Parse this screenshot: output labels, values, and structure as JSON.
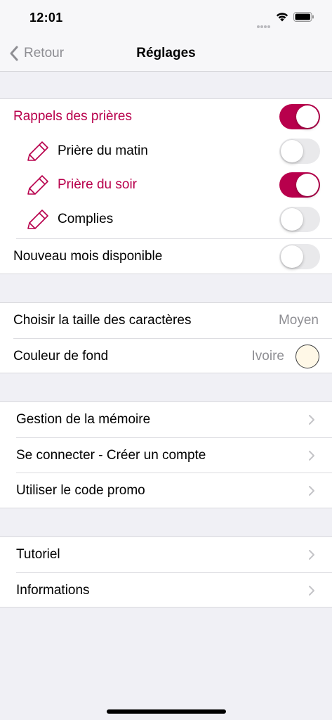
{
  "status_bar": {
    "time": "12:01"
  },
  "nav": {
    "back_label": "Retour",
    "title": "Réglages"
  },
  "prayer_reminders": {
    "label": "Rappels des prières",
    "enabled": true,
    "items": [
      {
        "label": "Prière du matin",
        "enabled": false
      },
      {
        "label": "Prière du soir",
        "enabled": true
      },
      {
        "label": "Complies",
        "enabled": false
      }
    ]
  },
  "new_month": {
    "label": "Nouveau mois disponible",
    "enabled": false
  },
  "display": {
    "font_size": {
      "label": "Choisir la taille des caractères",
      "value": "Moyen"
    },
    "background": {
      "label": "Couleur de fond",
      "value": "Ivoire",
      "swatch_color": "#FFF8E7"
    }
  },
  "account": {
    "items": [
      {
        "label": "Gestion de la mémoire"
      },
      {
        "label": "Se connecter - Créer un compte"
      },
      {
        "label": "Utiliser le code promo"
      }
    ]
  },
  "help": {
    "items": [
      {
        "label": "Tutoriel"
      },
      {
        "label": "Informations"
      }
    ]
  },
  "colors": {
    "accent": "#B8004C",
    "toggle_off": "#E9E9EB",
    "secondary_text": "#8E8E93",
    "grouped_background": "#F0F0F5"
  }
}
